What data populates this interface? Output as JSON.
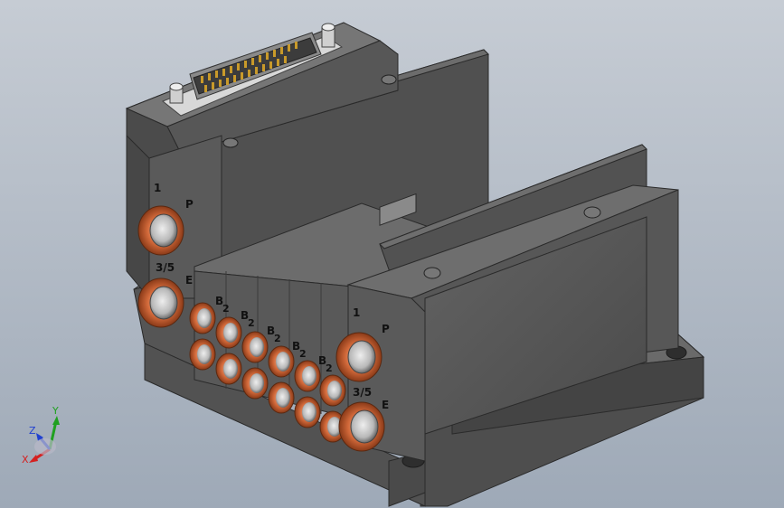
{
  "viewport": {
    "background_top": "#c6ccd4",
    "background_bottom": "#9ea9b7"
  },
  "model": {
    "body_color": "#5b5b5b",
    "fitting_color": "#d2693a",
    "pin_color": "#c99a2a"
  },
  "port_labels": {
    "left_p_num": "1",
    "left_p_letter": "P",
    "left_e_num": "3/5",
    "left_e_letter": "E",
    "right_p_num": "1",
    "right_p_letter": "P",
    "right_e_num": "3/5",
    "right_e_letter": "E"
  },
  "station_labels": [
    {
      "a": "B",
      "b": "2"
    },
    {
      "a": "B",
      "b": "2"
    },
    {
      "a": "B",
      "b": "2"
    },
    {
      "a": "B",
      "b": "2"
    },
    {
      "a": "B",
      "b": "2"
    }
  ],
  "triad": {
    "x_label": "X",
    "y_label": "Y",
    "z_label": "Z",
    "x_color": "#d42020",
    "y_color": "#20a020",
    "z_color": "#2040d0"
  }
}
